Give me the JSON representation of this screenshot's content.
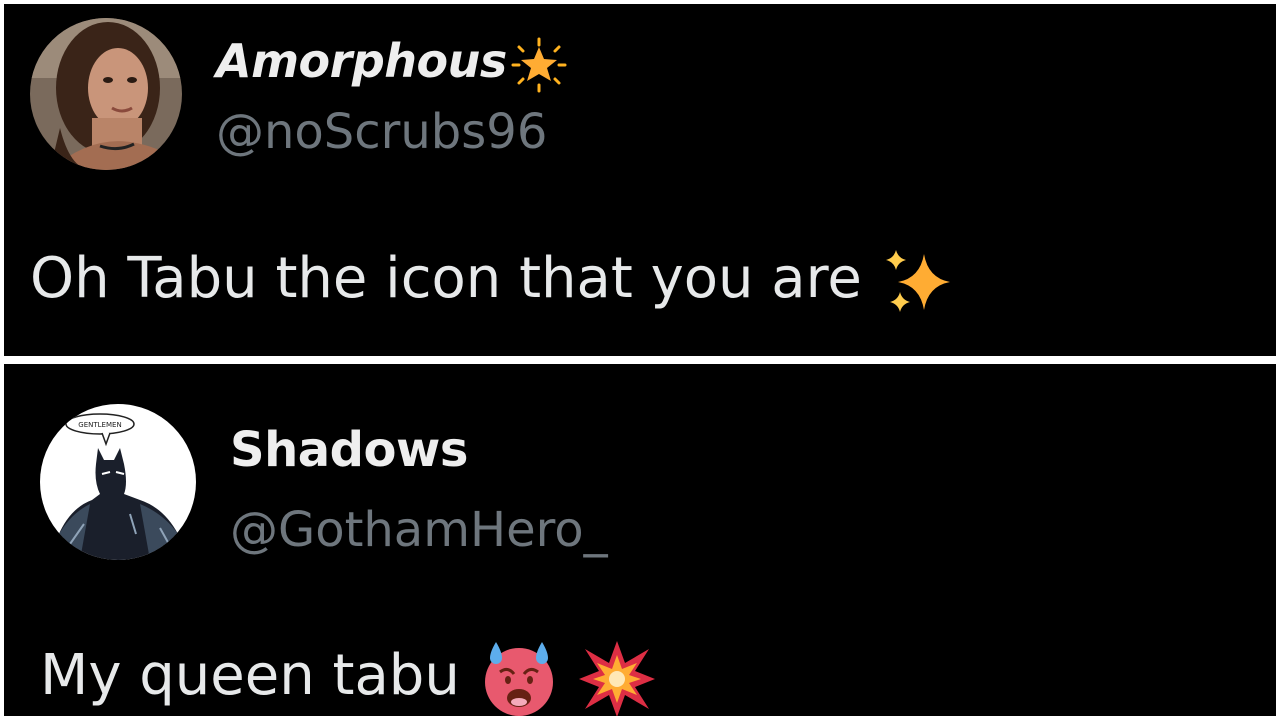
{
  "tweets": [
    {
      "display_name": "Amorphous",
      "name_emoji": "glowing-star-icon",
      "handle": "@noScrubs96",
      "text": "Oh Tabu the icon that you are",
      "text_emoji": [
        "sparkles-icon"
      ]
    },
    {
      "display_name": "Shadows",
      "handle": "@GothamHero_",
      "text": "My queen tabu",
      "text_emoji": [
        "hot-face-sweat-icon",
        "collision-icon"
      ],
      "avatar_caption": "GENTLEMEN"
    }
  ],
  "colors": {
    "background": "#000000",
    "name": "#eeeeee",
    "handle": "#6e767d",
    "text": "#e7e9ea",
    "divider": "#ffffff"
  }
}
